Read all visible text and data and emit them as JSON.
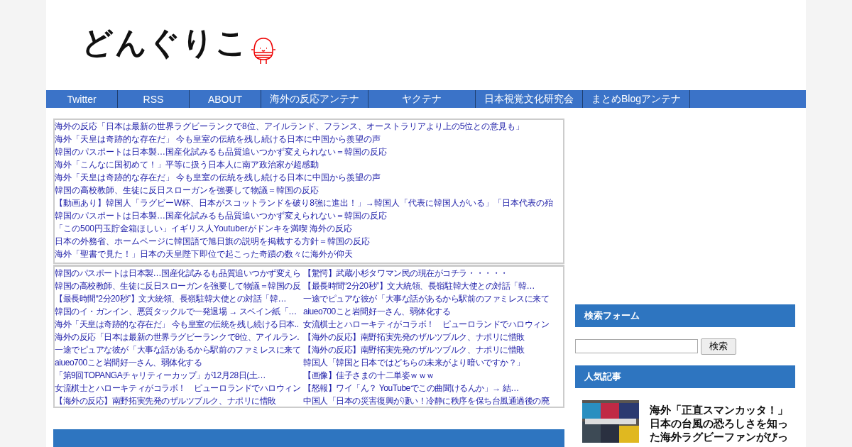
{
  "logo": {
    "text": "どんぐりこ"
  },
  "nav": [
    {
      "label": "Twitter"
    },
    {
      "label": "RSS"
    },
    {
      "label": "ABOUT"
    },
    {
      "label": "海外の反応アンテナ"
    },
    {
      "label": "ヤクテナ"
    },
    {
      "label": "日本視覚文化研究会"
    },
    {
      "label": "まとめBlogアンテナ"
    }
  ],
  "antenna_list": [
    "海外の反応「日本は最新の世界ラグビーランクで8位、アイルランド、フランス、オーストラリアより上の5位との意見も」",
    "海外「天皇は奇跡的な存在だ」 今も皇室の伝統を残し続ける日本に中国から羨望の声",
    "韓国のパスポートは日本製…国産化試みるも品質追いつかず変えられない＝韓国の反応",
    "海外「こんなに国初めて！」平等に扱う日本人に南ア政治家が超感動",
    "海外「天皇は奇跡的な存在だ」 今も皇室の伝統を残し続ける日本に中国から羨望の声",
    "韓国の高校教師、生徒に反日スローガンを強要して物議＝韓国の反応",
    "【動画あり】韓国人「ラグビーW杯、日本がスコットランドを破り8強に進出！」→韓国人「代表に韓国人がいる」「日本代表の殆",
    "韓国のパスポートは日本製…国産化試みるも品質追いつかず変えられない＝韓国の反応",
    "「この500円玉貯金箱ほしい」イギリス人Youtuberがドンキを満喫 海外の反応",
    "日本の外務省、ホームページに韓国語で旭日旗の説明を掲載する方針＝韓国の反応",
    "海外「聖書で見た！」日本の天皇陛下即位で起こった奇蹟の数々に海外が仰天"
  ],
  "link_columns": [
    [
      "韓国のパスポートは日本製…国産化試みるも品質追いつかず変えら",
      "韓国の高校教師、生徒に反日スローガンを強要して物議＝韓国の反",
      "【最長時間“2分20秒”】文大統領、長嶺駐韓大使との対話「韓…",
      "韓国のイ・ガンイン、悪質タックルで一発退場 → スペイン紙「…",
      "海外「天皇は奇跡的な存在だ」 今も皇室の伝統を残し続ける日本..",
      "海外の反応「日本は最新の世界ラグビーランクで8位、アイルラン.",
      "一途でピュアな彼が「大事な話があるから駅前のファミレスに来て",
      "aiueo700こと岩間好一さん、弱体化する",
      "「第9回TOPANGAチャリティーカップ」が12月28日(土…",
      "女流棋士とハローキティがコラボ！　ピューロランドでハロウィン",
      "【海外の反応】南野拓実先発のザルツブルク、ナポリに惜敗"
    ],
    [
      "【驚愕】武蔵小杉タワマン民の現在がコチラ・・・・・",
      "【最長時間“2分20秒”】文大統領、長嶺駐韓大使との対話「韓…",
      "一途でピュアな彼が「大事な話があるから駅前のファミレスに来て",
      "aiueo700こと岩間好一さん、弱体化する",
      "女流棋士とハローキティがコラボ！　ピューロランドでハロウィン",
      "【海外の反応】南野拓実先発のザルツブルク、ナポリに惜敗",
      "【海外の反応】南野拓実先発のザルツブルク、ナポリに惜敗",
      "韓国人「韓国と日本ではどちらの未来がより暗いですか？」",
      "【画像】佳子さまの十二単姿ｗｗｗ",
      "【怒報】ワイ「ん？ YouTubeでこの曲聞けるんか」→ 結…",
      "中国人「日本の災害復興が凄い！冷静に秩序を保ち台風通過後の廃"
    ]
  ],
  "sidebar": {
    "search_heading": "検索フォーム",
    "search_button": "検索",
    "popular_heading": "人気記事",
    "popular": [
      {
        "kind": "picture",
        "title": "海外「正直スマンカッタ！」日本の台風の恐ろしさを知った海外ラグビーファンがびっ"
      }
    ]
  }
}
